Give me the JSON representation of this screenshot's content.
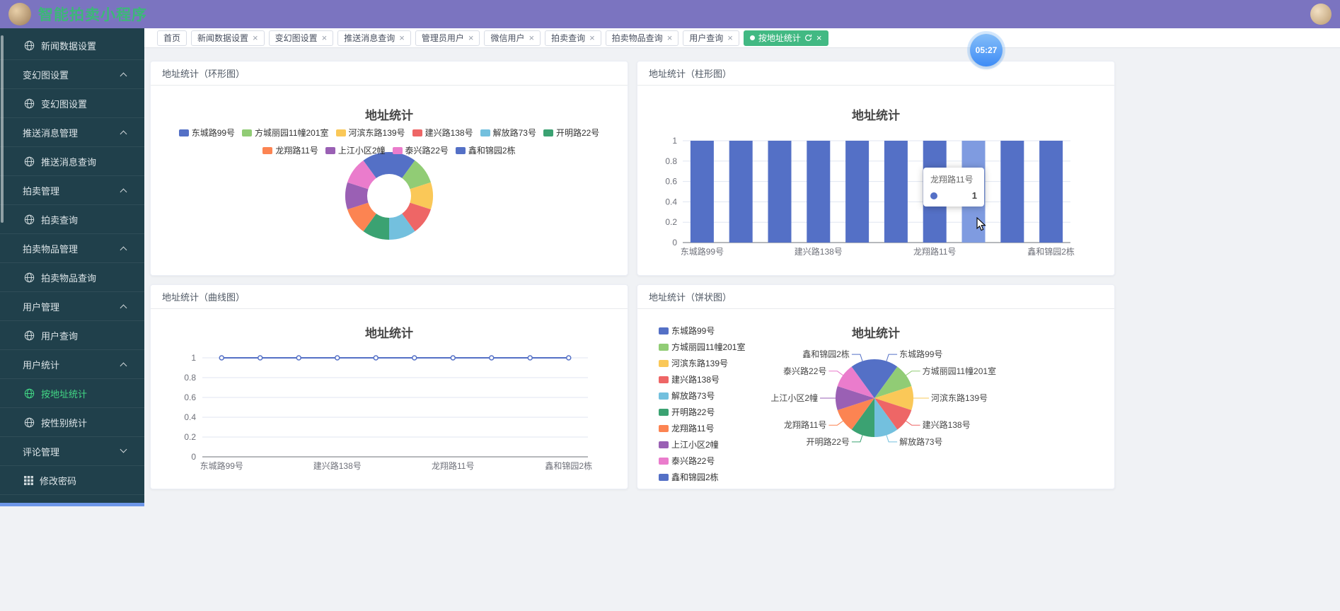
{
  "header": {
    "title": "智能拍卖小程序"
  },
  "sidebar": {
    "items": [
      {
        "label": "新闻数据设置",
        "type": "leaf",
        "icon": "globe",
        "active": false
      },
      {
        "label": "变幻图设置",
        "type": "parent",
        "arrow": "up",
        "active": false
      },
      {
        "label": "变幻图设置",
        "type": "child",
        "icon": "globe",
        "active": false
      },
      {
        "label": "推送消息管理",
        "type": "parent",
        "arrow": "up",
        "active": false
      },
      {
        "label": "推送消息查询",
        "type": "child",
        "icon": "globe",
        "active": false
      },
      {
        "label": "拍卖管理",
        "type": "parent",
        "arrow": "up",
        "active": false
      },
      {
        "label": "拍卖查询",
        "type": "child",
        "icon": "globe",
        "active": false
      },
      {
        "label": "拍卖物品管理",
        "type": "parent",
        "arrow": "up",
        "active": false
      },
      {
        "label": "拍卖物品查询",
        "type": "child",
        "icon": "globe",
        "active": false
      },
      {
        "label": "用户管理",
        "type": "parent",
        "arrow": "up",
        "active": false
      },
      {
        "label": "用户查询",
        "type": "child",
        "icon": "globe",
        "active": false
      },
      {
        "label": "用户统计",
        "type": "parent",
        "arrow": "up",
        "active": false
      },
      {
        "label": "按地址统计",
        "type": "child",
        "icon": "globe",
        "active": true
      },
      {
        "label": "按性别统计",
        "type": "child",
        "icon": "globe",
        "active": false
      },
      {
        "label": "评论管理",
        "type": "parent",
        "arrow": "down",
        "active": false
      },
      {
        "label": "修改密码",
        "type": "leaf",
        "icon": "grid",
        "active": false
      }
    ]
  },
  "tabs": {
    "items": [
      {
        "label": "首页",
        "closable": false,
        "active": false
      },
      {
        "label": "新闻数据设置",
        "closable": true,
        "active": false
      },
      {
        "label": "变幻图设置",
        "closable": true,
        "active": false
      },
      {
        "label": "推送消息查询",
        "closable": true,
        "active": false
      },
      {
        "label": "管理员用户",
        "closable": true,
        "active": false
      },
      {
        "label": "微信用户",
        "closable": true,
        "active": false
      },
      {
        "label": "拍卖查询",
        "closable": true,
        "active": false
      },
      {
        "label": "拍卖物品查询",
        "closable": true,
        "active": false
      },
      {
        "label": "用户查询",
        "closable": true,
        "active": false
      },
      {
        "label": "按地址统计",
        "closable": true,
        "active": true
      }
    ]
  },
  "timer": {
    "value": "05:27"
  },
  "cards": [
    {
      "title": "地址统计（环形图）"
    },
    {
      "title": "地址统计（柱形图）"
    },
    {
      "title": "地址统计（曲线图）"
    },
    {
      "title": "地址统计（饼状图）"
    }
  ],
  "chart_data": [
    {
      "type": "pie",
      "variant": "donut",
      "title": "地址统计",
      "legend_position": "top",
      "labels": [
        "东城路99号",
        "方城丽园11幢201室",
        "河滨东路139号",
        "建兴路138号",
        "解放路73号",
        "开明路22号",
        "龙翔路11号",
        "上江小区2幢",
        "泰兴路22号",
        "鑫和锦园2栋"
      ],
      "values": [
        1,
        1,
        1,
        1,
        1,
        1,
        1,
        1,
        1,
        1
      ],
      "colors": [
        "#5470c6",
        "#91cc75",
        "#fac858",
        "#ee6666",
        "#73c0de",
        "#3ba272",
        "#fc8452",
        "#9a60b4",
        "#ea7ccc",
        "#5470c6"
      ],
      "legend_rows": [
        [
          0,
          1,
          2,
          3,
          4,
          5
        ],
        [
          6,
          7,
          8,
          9
        ]
      ]
    },
    {
      "type": "bar",
      "title": "地址统计",
      "categories": [
        "东城路99号",
        "方城丽园11幢201室",
        "河滨东路139号",
        "建兴路138号",
        "解放路73号",
        "开明路22号",
        "龙翔路11号",
        "上江小区2幢",
        "泰兴路22号",
        "鑫和锦园2栋"
      ],
      "values": [
        1,
        1,
        1,
        1,
        1,
        1,
        1,
        1,
        1,
        1
      ],
      "ylim": [
        0,
        1
      ],
      "yticks": [
        0,
        0.2,
        0.4,
        0.6,
        0.8,
        1
      ],
      "xtick_indices": [
        0,
        3,
        6,
        9
      ],
      "bar_color": "#5470c6",
      "hover_index": 7,
      "hover_color": "#7f9be0",
      "grid": true,
      "tooltip": {
        "label": "龙翔路11号",
        "value": "1"
      }
    },
    {
      "type": "line",
      "title": "地址统计",
      "categories": [
        "东城路99号",
        "方城丽园11幢201室",
        "河滨东路139号",
        "建兴路138号",
        "解放路73号",
        "开明路22号",
        "龙翔路11号",
        "上江小区2幢",
        "泰兴路22号",
        "鑫和锦园2栋"
      ],
      "values": [
        1,
        1,
        1,
        1,
        1,
        1,
        1,
        1,
        1,
        1
      ],
      "ylim": [
        0,
        1
      ],
      "yticks": [
        0,
        0.2,
        0.4,
        0.6,
        0.8,
        1
      ],
      "xtick_indices": [
        0,
        3,
        6,
        9
      ],
      "line_color": "#5470c6",
      "grid": true
    },
    {
      "type": "pie",
      "title": "地址统计",
      "legend_position": "left",
      "labels": [
        "东城路99号",
        "方城丽园11幢201室",
        "河滨东路139号",
        "建兴路138号",
        "解放路73号",
        "开明路22号",
        "龙翔路11号",
        "上江小区2幢",
        "泰兴路22号",
        "鑫和锦园2栋"
      ],
      "values": [
        1,
        1,
        1,
        1,
        1,
        1,
        1,
        1,
        1,
        1
      ],
      "colors": [
        "#5470c6",
        "#91cc75",
        "#fac858",
        "#ee6666",
        "#73c0de",
        "#3ba272",
        "#fc8452",
        "#9a60b4",
        "#ea7ccc",
        "#5470c6"
      ]
    }
  ]
}
